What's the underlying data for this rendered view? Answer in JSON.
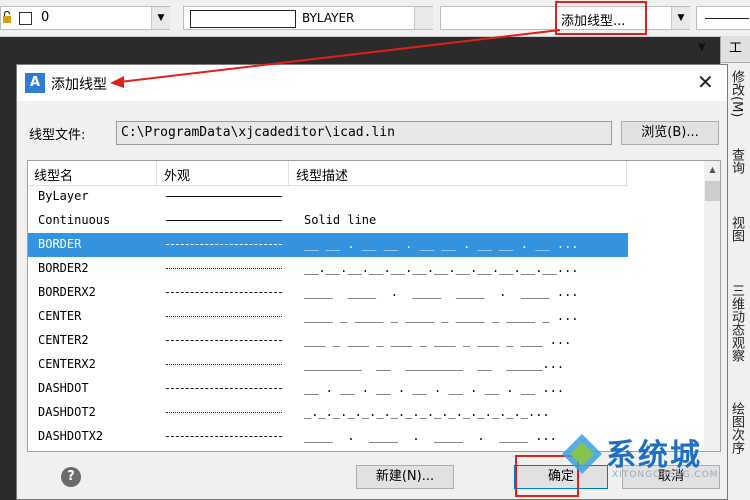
{
  "toolbar": {
    "layer_value": "0",
    "color_value": "BYLAYER",
    "linetype_value": "添加线型..."
  },
  "sidebar": {
    "top_label": "工",
    "tabs": [
      "修改(M)",
      "查询",
      "视图",
      "三维动态观察",
      "绘图次序"
    ]
  },
  "dialog": {
    "title": "添加线型",
    "file_label": "线型文件:",
    "file_path": "C:\\ProgramData\\xjcadeditor\\icad.lin",
    "browse_label": "浏览(B)...",
    "columns": [
      "线型名",
      "外观",
      "线型描述"
    ],
    "rows": [
      {
        "name": "ByLayer",
        "desc": ""
      },
      {
        "name": "Continuous",
        "desc": "Solid line"
      },
      {
        "name": "BORDER",
        "desc": "__ __ . __ __ . __ __ . __ __ . __ ..."
      },
      {
        "name": "BORDER2",
        "desc": "__.__.__.__.__.__.__.__.__.__.__.__..."
      },
      {
        "name": "BORDERX2",
        "desc": "____  ____  .  ____  ____  .  ____ ..."
      },
      {
        "name": "CENTER",
        "desc": "____ _ ____ _ ____ _ ____ _ ____ _ ..."
      },
      {
        "name": "CENTER2",
        "desc": "___ _ ___ _ ___ _ ___ _ ___ _ ___ ..."
      },
      {
        "name": "CENTERX2",
        "desc": "________  __  ________  __  _____..."
      },
      {
        "name": "DASHDOT",
        "desc": "__ . __ . __ . __ . __ . __ . __ ..."
      },
      {
        "name": "DASHDOT2",
        "desc": "_._._._._._._._._._._._._._._._..."
      },
      {
        "name": "DASHDOTX2",
        "desc": "____  .  ____  .  ____  .  ____ ..."
      }
    ],
    "selected_index": 2,
    "new_label": "新建(N)...",
    "ok_label": "确定",
    "cancel_label": "取消",
    "help_glyph": "?"
  },
  "watermark": {
    "text": "系统城",
    "sub": "XITONGCHENG.COM"
  },
  "colors": {
    "selection": "#3393df",
    "highlight_box": "#e0201a",
    "brand_blue": "#1e6fc2"
  }
}
